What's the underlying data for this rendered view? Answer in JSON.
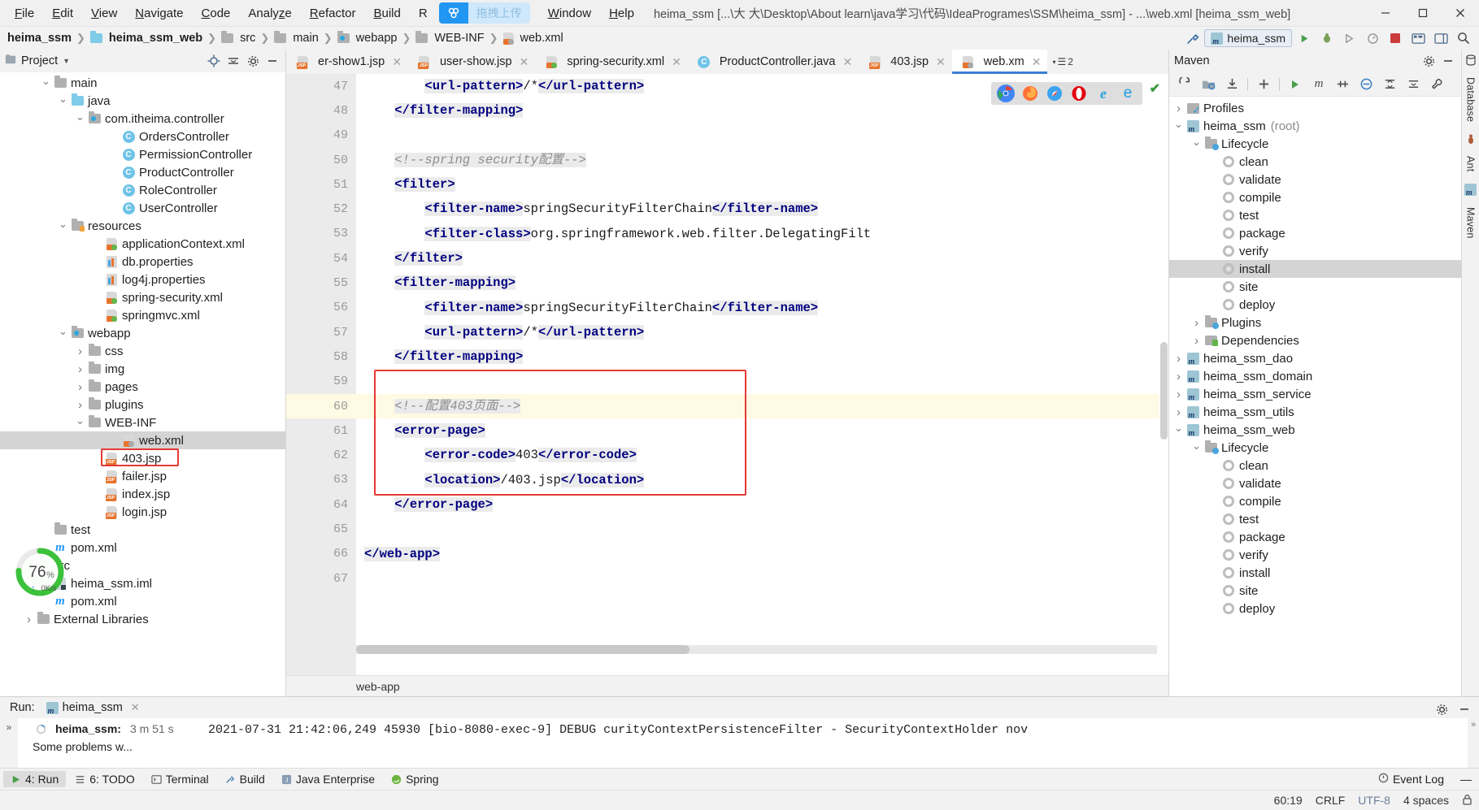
{
  "titlebar": {
    "menus": [
      "File",
      "Edit",
      "View",
      "Navigate",
      "Code",
      "Analyze",
      "Refactor",
      "Build",
      "R"
    ],
    "menus_after": [
      "Window",
      "Help"
    ],
    "upload_label": "拖拽上传",
    "window_title": "heima_ssm [...\\大 大\\Desktop\\About learn\\java学习\\代码\\IdeaProgrames\\SSM\\heima_ssm] - ...\\web.xml [heima_ssm_web]",
    "minimize": "—",
    "maximize": "▭",
    "close": "✕"
  },
  "breadcrumb": {
    "items": [
      {
        "label": "heima_ssm",
        "icon": "none",
        "bold": true
      },
      {
        "label": "heima_ssm_web",
        "icon": "module",
        "bold": true
      },
      {
        "label": "src",
        "icon": "folder",
        "bold": false
      },
      {
        "label": "main",
        "icon": "folder",
        "bold": false
      },
      {
        "label": "webapp",
        "icon": "webfolder",
        "bold": false
      },
      {
        "label": "WEB-INF",
        "icon": "folder",
        "bold": false
      },
      {
        "label": "web.xml",
        "icon": "xml",
        "bold": false
      }
    ],
    "separator": "❯",
    "run_config": "heima_ssm"
  },
  "project_panel": {
    "title": "Project",
    "tree": [
      {
        "depth": 3,
        "label": "main",
        "icon": "folder",
        "arrow": "down",
        "sel": false
      },
      {
        "depth": 4,
        "label": "java",
        "icon": "folder-blue",
        "arrow": "down",
        "sel": false
      },
      {
        "depth": 5,
        "label": "com.itheima.controller",
        "icon": "folder-web",
        "arrow": "down",
        "sel": false
      },
      {
        "depth": 7,
        "label": "OrdersController",
        "icon": "class",
        "arrow": "",
        "sel": false
      },
      {
        "depth": 7,
        "label": "PermissionController",
        "icon": "class",
        "arrow": "",
        "sel": false
      },
      {
        "depth": 7,
        "label": "ProductController",
        "icon": "class",
        "arrow": "",
        "sel": false
      },
      {
        "depth": 7,
        "label": "RoleController",
        "icon": "class",
        "arrow": "",
        "sel": false
      },
      {
        "depth": 7,
        "label": "UserController",
        "icon": "class",
        "arrow": "",
        "sel": false
      },
      {
        "depth": 4,
        "label": "resources",
        "icon": "folder-res",
        "arrow": "down",
        "sel": false
      },
      {
        "depth": 6,
        "label": "applicationContext.xml",
        "icon": "xml-green",
        "arrow": "",
        "sel": false
      },
      {
        "depth": 6,
        "label": "db.properties",
        "icon": "prop",
        "arrow": "",
        "sel": false
      },
      {
        "depth": 6,
        "label": "log4j.properties",
        "icon": "prop",
        "arrow": "",
        "sel": false
      },
      {
        "depth": 6,
        "label": "spring-security.xml",
        "icon": "xml-green",
        "arrow": "",
        "sel": false
      },
      {
        "depth": 6,
        "label": "springmvc.xml",
        "icon": "xml-green",
        "arrow": "",
        "sel": false
      },
      {
        "depth": 4,
        "label": "webapp",
        "icon": "folder-web",
        "arrow": "down",
        "sel": false
      },
      {
        "depth": 5,
        "label": "css",
        "icon": "folder",
        "arrow": "right",
        "sel": false
      },
      {
        "depth": 5,
        "label": "img",
        "icon": "folder",
        "arrow": "right",
        "sel": false
      },
      {
        "depth": 5,
        "label": "pages",
        "icon": "folder",
        "arrow": "right",
        "sel": false
      },
      {
        "depth": 5,
        "label": "plugins",
        "icon": "folder",
        "arrow": "right",
        "sel": false
      },
      {
        "depth": 5,
        "label": "WEB-INF",
        "icon": "folder",
        "arrow": "down",
        "sel": false
      },
      {
        "depth": 7,
        "label": "web.xml",
        "icon": "xml-gray",
        "arrow": "",
        "sel": true
      },
      {
        "depth": 6,
        "label": "403.jsp",
        "icon": "jsp",
        "arrow": "",
        "sel": false,
        "highlight": true
      },
      {
        "depth": 6,
        "label": "failer.jsp",
        "icon": "jsp",
        "arrow": "",
        "sel": false
      },
      {
        "depth": 6,
        "label": "index.jsp",
        "icon": "jsp",
        "arrow": "",
        "sel": false
      },
      {
        "depth": 6,
        "label": "login.jsp",
        "icon": "jsp",
        "arrow": "",
        "sel": false
      },
      {
        "depth": 3,
        "label": "test",
        "icon": "folder",
        "arrow": "",
        "sel": false
      },
      {
        "depth": 3,
        "label": "pom.xml",
        "icon": "maven-m",
        "arrow": "",
        "sel": false
      },
      {
        "depth": 2,
        "label": "src",
        "icon": "folder",
        "arrow": "right",
        "sel": false
      },
      {
        "depth": 3,
        "label": "heima_ssm.iml",
        "icon": "iml",
        "arrow": "",
        "sel": false
      },
      {
        "depth": 3,
        "label": "pom.xml",
        "icon": "maven-m",
        "arrow": "",
        "sel": false
      },
      {
        "depth": 2,
        "label": "External Libraries",
        "icon": "folder",
        "arrow": "right",
        "sel": false
      }
    ],
    "cpu_widget": {
      "percent": "76",
      "percent_unit": "%",
      "netspeed": "0K/s",
      "arrow": "↑",
      "color": "#3cc13b"
    }
  },
  "editor": {
    "tabs": [
      {
        "label": "er-show1.jsp",
        "icon": "jsp",
        "active": false,
        "closable": true
      },
      {
        "label": "user-show.jsp",
        "icon": "jsp",
        "active": false,
        "closable": true
      },
      {
        "label": "spring-security.xml",
        "icon": "xml-green",
        "active": false,
        "closable": true
      },
      {
        "label": "ProductController.java",
        "icon": "class",
        "active": false,
        "closable": true
      },
      {
        "label": "403.jsp",
        "icon": "jsp",
        "active": false,
        "closable": true
      },
      {
        "label": "web.xm",
        "icon": "xml-gray",
        "active": true,
        "closable": true
      }
    ],
    "tab_overflow_count": "2",
    "breadcrumb_bottom": "web-app",
    "browsers": [
      "chrome",
      "firefox",
      "safari",
      "opera",
      "ie",
      "edge"
    ],
    "inspection_ok": "✔",
    "lines": [
      {
        "n": 47,
        "fold": "",
        "hl": false,
        "parts": [
          {
            "t": "        ",
            "c": "plain"
          },
          {
            "t": "<url-pattern>",
            "c": "tag"
          },
          {
            "t": "/*",
            "c": "txt"
          },
          {
            "t": "</url-pattern>",
            "c": "tag"
          }
        ]
      },
      {
        "n": 48,
        "fold": "end",
        "hl": false,
        "parts": [
          {
            "t": "    ",
            "c": "plain"
          },
          {
            "t": "</filter-mapping>",
            "c": "tag"
          }
        ]
      },
      {
        "n": 49,
        "fold": "",
        "hl": false,
        "parts": []
      },
      {
        "n": 50,
        "fold": "",
        "hl": false,
        "parts": [
          {
            "t": "    ",
            "c": "plain"
          },
          {
            "t": "<!--spring security配置-->",
            "c": "cmt"
          }
        ]
      },
      {
        "n": 51,
        "fold": "start",
        "hl": false,
        "parts": [
          {
            "t": "    ",
            "c": "plain"
          },
          {
            "t": "<filter>",
            "c": "tag"
          }
        ]
      },
      {
        "n": 52,
        "fold": "",
        "hl": false,
        "parts": [
          {
            "t": "        ",
            "c": "plain"
          },
          {
            "t": "<filter-name>",
            "c": "tag"
          },
          {
            "t": "springSecurityFilterChain",
            "c": "txt"
          },
          {
            "t": "</filter-name>",
            "c": "tag"
          }
        ]
      },
      {
        "n": 53,
        "fold": "",
        "hl": false,
        "parts": [
          {
            "t": "        ",
            "c": "plain"
          },
          {
            "t": "<filter-class>",
            "c": "tag"
          },
          {
            "t": "org.springframework.web.filter.DelegatingFilt",
            "c": "txt"
          }
        ]
      },
      {
        "n": 54,
        "fold": "end",
        "hl": false,
        "parts": [
          {
            "t": "    ",
            "c": "plain"
          },
          {
            "t": "</filter>",
            "c": "tag"
          }
        ]
      },
      {
        "n": 55,
        "fold": "start",
        "hl": false,
        "parts": [
          {
            "t": "    ",
            "c": "plain"
          },
          {
            "t": "<filter-mapping>",
            "c": "tag"
          }
        ]
      },
      {
        "n": 56,
        "fold": "",
        "hl": false,
        "parts": [
          {
            "t": "        ",
            "c": "plain"
          },
          {
            "t": "<filter-name>",
            "c": "tag"
          },
          {
            "t": "springSecurityFilterChain",
            "c": "txt"
          },
          {
            "t": "</filter-name>",
            "c": "tag"
          }
        ]
      },
      {
        "n": 57,
        "fold": "",
        "hl": false,
        "parts": [
          {
            "t": "        ",
            "c": "plain"
          },
          {
            "t": "<url-pattern>",
            "c": "tag"
          },
          {
            "t": "/*",
            "c": "txt"
          },
          {
            "t": "</url-pattern>",
            "c": "tag"
          }
        ]
      },
      {
        "n": 58,
        "fold": "end",
        "hl": false,
        "parts": [
          {
            "t": "    ",
            "c": "plain"
          },
          {
            "t": "</filter-mapping>",
            "c": "tag"
          }
        ]
      },
      {
        "n": 59,
        "fold": "",
        "hl": false,
        "parts": []
      },
      {
        "n": 60,
        "fold": "",
        "hl": true,
        "bulb": true,
        "parts": [
          {
            "t": "    ",
            "c": "plain"
          },
          {
            "t": "<!--配置403页面-->",
            "c": "cmt"
          }
        ]
      },
      {
        "n": 61,
        "fold": "start",
        "hl": false,
        "parts": [
          {
            "t": "    ",
            "c": "plain"
          },
          {
            "t": "<error-page>",
            "c": "tag"
          }
        ]
      },
      {
        "n": 62,
        "fold": "",
        "hl": false,
        "parts": [
          {
            "t": "        ",
            "c": "plain"
          },
          {
            "t": "<error-code>",
            "c": "tag"
          },
          {
            "t": "403",
            "c": "txt"
          },
          {
            "t": "</error-code>",
            "c": "tag"
          }
        ]
      },
      {
        "n": 63,
        "fold": "",
        "hl": false,
        "parts": [
          {
            "t": "        ",
            "c": "plain"
          },
          {
            "t": "<location>",
            "c": "tag"
          },
          {
            "t": "/403.jsp",
            "c": "txt"
          },
          {
            "t": "</location>",
            "c": "tag"
          }
        ]
      },
      {
        "n": 64,
        "fold": "end",
        "hl": false,
        "parts": [
          {
            "t": "    ",
            "c": "plain"
          },
          {
            "t": "</error-page>",
            "c": "tag"
          }
        ]
      },
      {
        "n": 65,
        "fold": "",
        "hl": false,
        "parts": []
      },
      {
        "n": 66,
        "fold": "end",
        "hl": false,
        "parts": [
          {
            "t": "",
            "c": "plain"
          },
          {
            "t": "</web-app>",
            "c": "tag"
          }
        ]
      },
      {
        "n": 67,
        "fold": "",
        "hl": false,
        "parts": []
      }
    ]
  },
  "maven_panel": {
    "title": "Maven",
    "toolbar_icons": [
      "refresh-icon",
      "add-module-icon",
      "download-sources-icon",
      "plus-icon",
      "run-icon",
      "maven-goal-icon",
      "skip-tests-icon",
      "toggle-offline-icon",
      "execute-icon",
      "expand-icon",
      "collapse-icon",
      "settings-icon"
    ],
    "tree": [
      {
        "depth": 0,
        "label": "Profiles",
        "icon": "profiles",
        "arrow": "right",
        "sel": false,
        "suffix": ""
      },
      {
        "depth": 0,
        "label": "heima_ssm",
        "icon": "maven",
        "arrow": "down",
        "sel": false,
        "suffix": " (root)"
      },
      {
        "depth": 1,
        "label": "Lifecycle",
        "icon": "lifecycle",
        "arrow": "down",
        "sel": false,
        "suffix": ""
      },
      {
        "depth": 2,
        "label": "clean",
        "icon": "gear",
        "arrow": "",
        "sel": false,
        "suffix": ""
      },
      {
        "depth": 2,
        "label": "validate",
        "icon": "gear",
        "arrow": "",
        "sel": false,
        "suffix": ""
      },
      {
        "depth": 2,
        "label": "compile",
        "icon": "gear",
        "arrow": "",
        "sel": false,
        "suffix": ""
      },
      {
        "depth": 2,
        "label": "test",
        "icon": "gear",
        "arrow": "",
        "sel": false,
        "suffix": ""
      },
      {
        "depth": 2,
        "label": "package",
        "icon": "gear",
        "arrow": "",
        "sel": false,
        "suffix": ""
      },
      {
        "depth": 2,
        "label": "verify",
        "icon": "gear",
        "arrow": "",
        "sel": false,
        "suffix": ""
      },
      {
        "depth": 2,
        "label": "install",
        "icon": "gear",
        "arrow": "",
        "sel": true,
        "suffix": ""
      },
      {
        "depth": 2,
        "label": "site",
        "icon": "gear",
        "arrow": "",
        "sel": false,
        "suffix": ""
      },
      {
        "depth": 2,
        "label": "deploy",
        "icon": "gear",
        "arrow": "",
        "sel": false,
        "suffix": ""
      },
      {
        "depth": 1,
        "label": "Plugins",
        "icon": "lifecycle",
        "arrow": "right",
        "sel": false,
        "suffix": ""
      },
      {
        "depth": 1,
        "label": "Dependencies",
        "icon": "deps",
        "arrow": "right",
        "sel": false,
        "suffix": ""
      },
      {
        "depth": 0,
        "label": "heima_ssm_dao",
        "icon": "maven",
        "arrow": "right",
        "sel": false,
        "suffix": ""
      },
      {
        "depth": 0,
        "label": "heima_ssm_domain",
        "icon": "maven",
        "arrow": "right",
        "sel": false,
        "suffix": ""
      },
      {
        "depth": 0,
        "label": "heima_ssm_service",
        "icon": "maven",
        "arrow": "right",
        "sel": false,
        "suffix": ""
      },
      {
        "depth": 0,
        "label": "heima_ssm_utils",
        "icon": "maven",
        "arrow": "right",
        "sel": false,
        "suffix": ""
      },
      {
        "depth": 0,
        "label": "heima_ssm_web",
        "icon": "maven",
        "arrow": "down",
        "sel": false,
        "suffix": ""
      },
      {
        "depth": 1,
        "label": "Lifecycle",
        "icon": "lifecycle",
        "arrow": "down",
        "sel": false,
        "suffix": ""
      },
      {
        "depth": 2,
        "label": "clean",
        "icon": "gear",
        "arrow": "",
        "sel": false,
        "suffix": ""
      },
      {
        "depth": 2,
        "label": "validate",
        "icon": "gear",
        "arrow": "",
        "sel": false,
        "suffix": ""
      },
      {
        "depth": 2,
        "label": "compile",
        "icon": "gear",
        "arrow": "",
        "sel": false,
        "suffix": ""
      },
      {
        "depth": 2,
        "label": "test",
        "icon": "gear",
        "arrow": "",
        "sel": false,
        "suffix": ""
      },
      {
        "depth": 2,
        "label": "package",
        "icon": "gear",
        "arrow": "",
        "sel": false,
        "suffix": ""
      },
      {
        "depth": 2,
        "label": "verify",
        "icon": "gear",
        "arrow": "",
        "sel": false,
        "suffix": ""
      },
      {
        "depth": 2,
        "label": "install",
        "icon": "gear",
        "arrow": "",
        "sel": false,
        "suffix": ""
      },
      {
        "depth": 2,
        "label": "site",
        "icon": "gear",
        "arrow": "",
        "sel": false,
        "suffix": ""
      },
      {
        "depth": 2,
        "label": "deploy",
        "icon": "gear",
        "arrow": "",
        "sel": false,
        "suffix": ""
      }
    ]
  },
  "right_strip": {
    "labels": [
      "Database",
      "Ant",
      "Maven"
    ]
  },
  "run_panel": {
    "label": "Run:",
    "config_name": "heima_ssm",
    "close": "✕",
    "tree": [
      {
        "label": "heima_ssm:",
        "suffix": "3 m 51 s",
        "bold": true,
        "icon": "spinner"
      },
      {
        "label": "Some problems w...",
        "suffix": "",
        "bold": false,
        "icon": "none"
      }
    ],
    "console_line": "2021-07-31 21:42:06,249 45930   [bio-8080-exec-9] DEBUG curityContextPersistenceFilter  - SecurityContextHolder nov"
  },
  "bottom_toolbar": {
    "items": [
      {
        "label": "4: Run",
        "icon": "run-icon",
        "active": true
      },
      {
        "label": "6: TODO",
        "icon": "todo-icon",
        "active": false
      },
      {
        "label": "Terminal",
        "icon": "terminal-icon",
        "active": false
      },
      {
        "label": "Build",
        "icon": "build-icon",
        "active": false
      },
      {
        "label": "Java Enterprise",
        "icon": "javaee-icon",
        "active": false
      },
      {
        "label": "Spring",
        "icon": "spring-icon",
        "active": false
      }
    ],
    "event_log": "Event Log"
  },
  "status_bar": {
    "position": "60:19",
    "line_sep": "CRLF",
    "encoding": "UTF-8",
    "indent": "4 spaces",
    "lock_icon": "🔒"
  },
  "colors": {
    "accent": "#3b7fd4",
    "tag": "#000080",
    "comment": "#8c8c8c",
    "highlight_line": "#fffae3",
    "selection": "#d4d4d4",
    "red_box": "#e53935",
    "cpu_green": "#3cc13b"
  }
}
